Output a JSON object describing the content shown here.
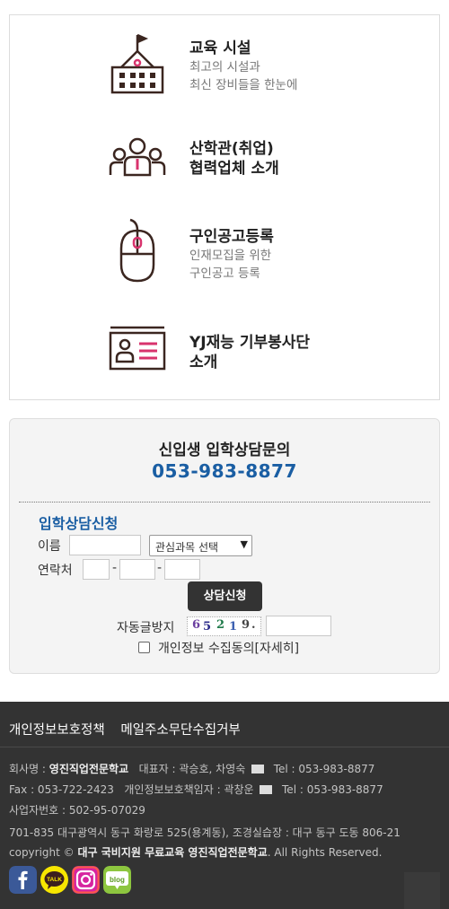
{
  "menu": [
    {
      "title": "교육 시설",
      "subtitle_lines": [
        "최고의 시설과",
        "최신 장비들을 한눈에"
      ],
      "icon": "school-building-icon"
    },
    {
      "title": "산학관(취업)",
      "subtitle_lines": [
        "협력업체 소개"
      ],
      "icon": "people-group-icon"
    },
    {
      "title": "구인공고등록",
      "subtitle_lines": [
        "인재모집을 위한",
        "구인공고 등록"
      ],
      "icon": "computer-mouse-icon"
    },
    {
      "title": "YJ재능 기부봉사단",
      "subtitle_lines": [
        "소개"
      ],
      "icon": "id-card-icon"
    }
  ],
  "consult": {
    "heading": "신입생 입학상담문의",
    "phone": "053-983-8877",
    "form_title": "입학상담신청",
    "name_label": "이름",
    "course_select": "관심과목 선택",
    "phone_label": "연락처",
    "dash": "-",
    "submit_label": "상담신청",
    "captcha_label": "자동글방지",
    "captcha_digits": [
      "6",
      "5",
      "2",
      "1",
      "9",
      "."
    ],
    "privacy_label": "개인정보 수집동의[자세히]"
  },
  "footer": {
    "links": [
      "개인정보보호정책",
      "메일주소무단수집거부"
    ],
    "company_prefix": "회사명 : ",
    "company_name": "영진직업전문학교",
    "ceo": "대표자 : 곽승호, 차영숙",
    "tel1": "Tel : 053-983-8877",
    "fax": "Fax : 053-722-2423",
    "privacy_officer": "개인정보보호책임자 : 곽창운",
    "tel2": "Tel : 053-983-8877",
    "biz_no": "사업자번호 : 502-95-07029",
    "address": "701-835 대구광역시 동구 화랑로 525(용계동), 조경실습장 : 대구 동구 도동 806-21",
    "copyright_prefix": "copyright © ",
    "copyright_name": "대구 국비지원 무료교육 영진직업전문학교",
    "copyright_suffix": ". All Rights Reserved.",
    "sns": [
      "facebook-icon",
      "kakaotalk-icon",
      "instagram-icon",
      "blog-icon"
    ]
  },
  "colors": {
    "accent_blue": "#1a5ea3",
    "accent_pink": "#d8336d",
    "footer_bg": "#333333",
    "icon_brown": "#3b2620"
  }
}
